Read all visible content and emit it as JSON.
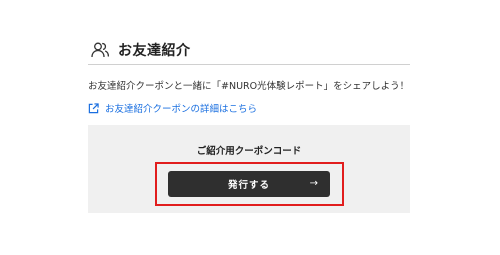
{
  "section": {
    "title": "お友達紹介",
    "icon": "users-icon"
  },
  "description": "お友達紹介クーポンと一緒に「#NURO光体験レポート」をシェアしよう！",
  "details_link": {
    "icon": "external-link-icon",
    "label": "お友達紹介クーポンの詳細はこちら"
  },
  "coupon_panel": {
    "title": "ご紹介用クーポンコード",
    "issue_button": {
      "label": "発行する",
      "icon": "arrow-right-icon"
    }
  },
  "colors": {
    "link": "#1a6fe0",
    "panel_bg": "#f0f0f0",
    "button_bg": "#2f2f2f",
    "highlight": "#e11d1d"
  }
}
